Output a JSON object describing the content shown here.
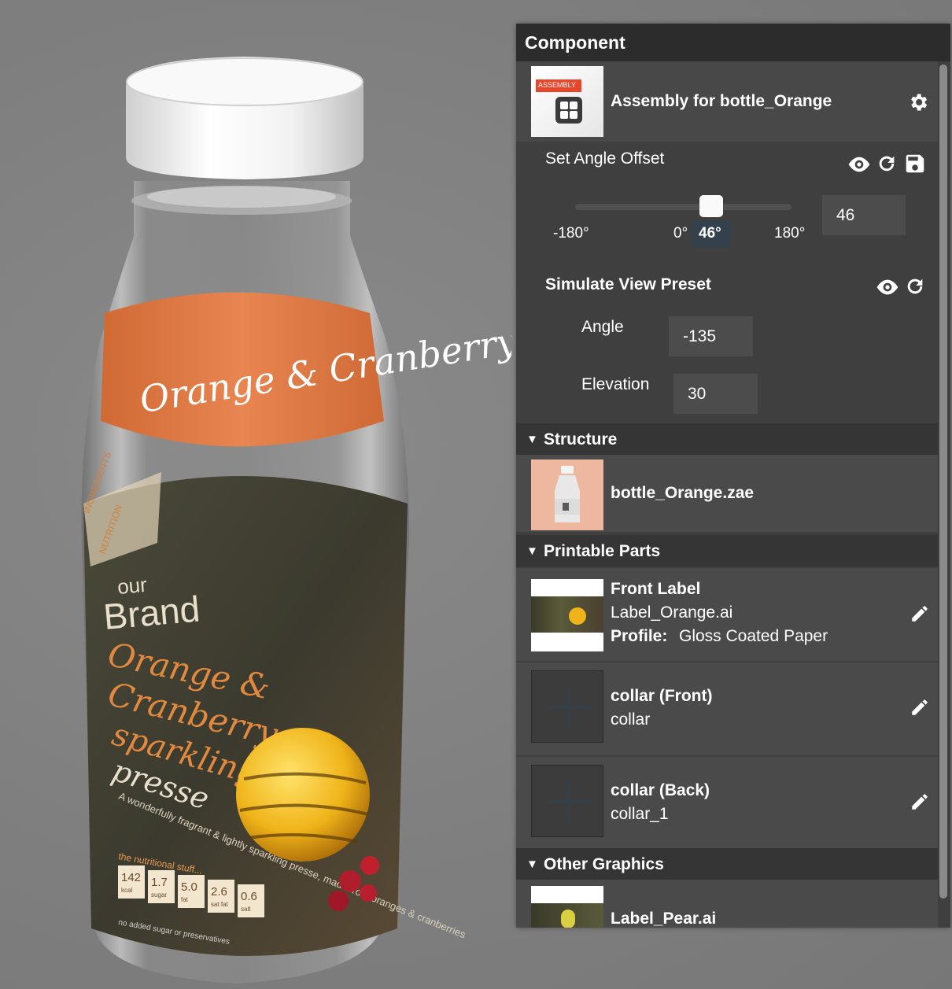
{
  "viewport": {
    "brand_small": "our",
    "brand_big": "Brand",
    "label_title_lines": [
      "Orange &",
      "Cranberry",
      "sparkling",
      "presse"
    ],
    "label_desc": "A wonderfully fragrant & lightly sparkling presse, made from oranges & cranberries",
    "collar_text": "Orange & Cranberry sparkling",
    "ingredients_title": "INGREDIENTS",
    "nutrition_title": "NUTRITION",
    "nutrition_header": "the nutritional stuff...",
    "nutrition": [
      {
        "value": "142",
        "unit": "kcal"
      },
      {
        "value": "1.7",
        "unit": "sugar"
      },
      {
        "value": "5.0",
        "unit": "fat"
      },
      {
        "value": "2.6",
        "unit": "sat fat"
      },
      {
        "value": "0.6",
        "unit": "salt"
      }
    ],
    "no_additives": "no added sugar or preservatives"
  },
  "panel": {
    "title": "Component",
    "assembly": {
      "badge": "ASSEMBLY",
      "name": "Assembly for bottle_Orange",
      "settings_icon": "gear-icon"
    },
    "angle_offset": {
      "label": "Set Angle Offset",
      "min_label": "-180°",
      "zero_label": "0°",
      "max_label": "180°",
      "tooltip": "46°",
      "value": "46",
      "slider_fraction": 0.628,
      "icons": [
        "eye-icon",
        "refresh-icon",
        "save-icon"
      ]
    },
    "view_preset": {
      "label": "Simulate View Preset",
      "angle_label": "Angle",
      "angle_value": "-135",
      "elevation_label": "Elevation",
      "elevation_value": "30",
      "icons": [
        "eye-icon",
        "refresh-icon"
      ]
    },
    "structure": {
      "title": "Structure",
      "file": "bottle_Orange.zae"
    },
    "printable_parts": {
      "title": "Printable Parts",
      "items": [
        {
          "name": "Front Label",
          "file": "Label_Orange.ai",
          "profile_label": "Profile:",
          "profile_value": "Gloss Coated Paper"
        },
        {
          "name": "collar (Front)",
          "file": "collar"
        },
        {
          "name": "collar (Back)",
          "file": "collar_1"
        }
      ],
      "edit_icon": "pencil-icon"
    },
    "other_graphics": {
      "title": "Other Graphics",
      "items": [
        {
          "file": "Label_Pear.ai"
        }
      ]
    }
  },
  "colors": {
    "panel_bg": "#3f3f3f",
    "panel_header": "#2c2c2c",
    "section_header": "#353535",
    "accent_orange": "#e37a3f",
    "badge_red": "#e8452a",
    "structure_thumb": "#eeb8a0"
  }
}
